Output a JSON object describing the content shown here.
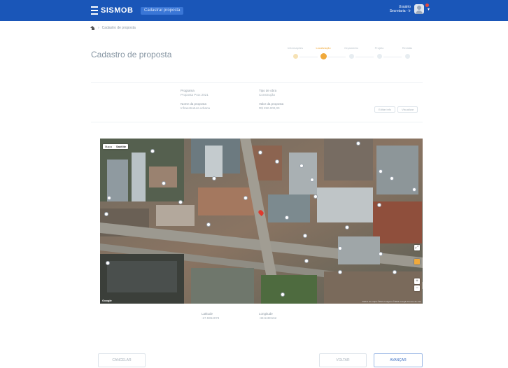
{
  "header": {
    "brand": "SISMOB",
    "project_button": "Cadastrar proposta",
    "user_line1": "Usuário",
    "user_line2": "Secretaria - Ir"
  },
  "breadcrumb": {
    "current": "Cadastro de proposta"
  },
  "page": {
    "title": "Cadastro de proposta"
  },
  "stepper": {
    "steps": [
      {
        "label": "Informações",
        "state": "done"
      },
      {
        "label": "Localização",
        "state": "active"
      },
      {
        "label": "Orçamento",
        "state": "todo"
      },
      {
        "label": "Projeto",
        "state": "todo"
      },
      {
        "label": "Revisão",
        "state": "todo"
      }
    ]
  },
  "info": {
    "programa_label": "Programa",
    "programa_value": "Proposta Prox 2021",
    "tipo_label": "Tipo de obra",
    "tipo_value": "Construção",
    "nome_label": "Nome da proposta",
    "nome_value": "Infraestrutura urbana",
    "valor_label": "Valor da proposta",
    "valor_value": "R$ 250.000,00",
    "btn_edit": "Editar info",
    "btn_view": "Visualizar"
  },
  "map": {
    "view_map": "Mapa",
    "view_satellite": "Satélite",
    "attribution": "Dados do mapa ©2021 Imagens ©2021 Google  Termos de Uso",
    "google": "Google",
    "fullscreen_icon": "fullscreen-icon",
    "zoom_in_icon": "plus-icon",
    "zoom_out_icon": "minus-icon",
    "pegman_icon": "pegman-icon",
    "colors": {
      "pin": "#e0392d",
      "pegman": "#f0a93b"
    }
  },
  "coords": {
    "lat_label": "Latitude",
    "lat_value": "-27.5954078",
    "lng_label": "Longitude",
    "lng_value": "-48.5480162"
  },
  "footer": {
    "back": "CANCELAR",
    "prev": "VOLTAR",
    "next": "AVANÇAR"
  },
  "colors": {
    "topbar": "#1a56b8",
    "accent": "#f0a93b",
    "primary_outline": "#3d6fc2"
  }
}
